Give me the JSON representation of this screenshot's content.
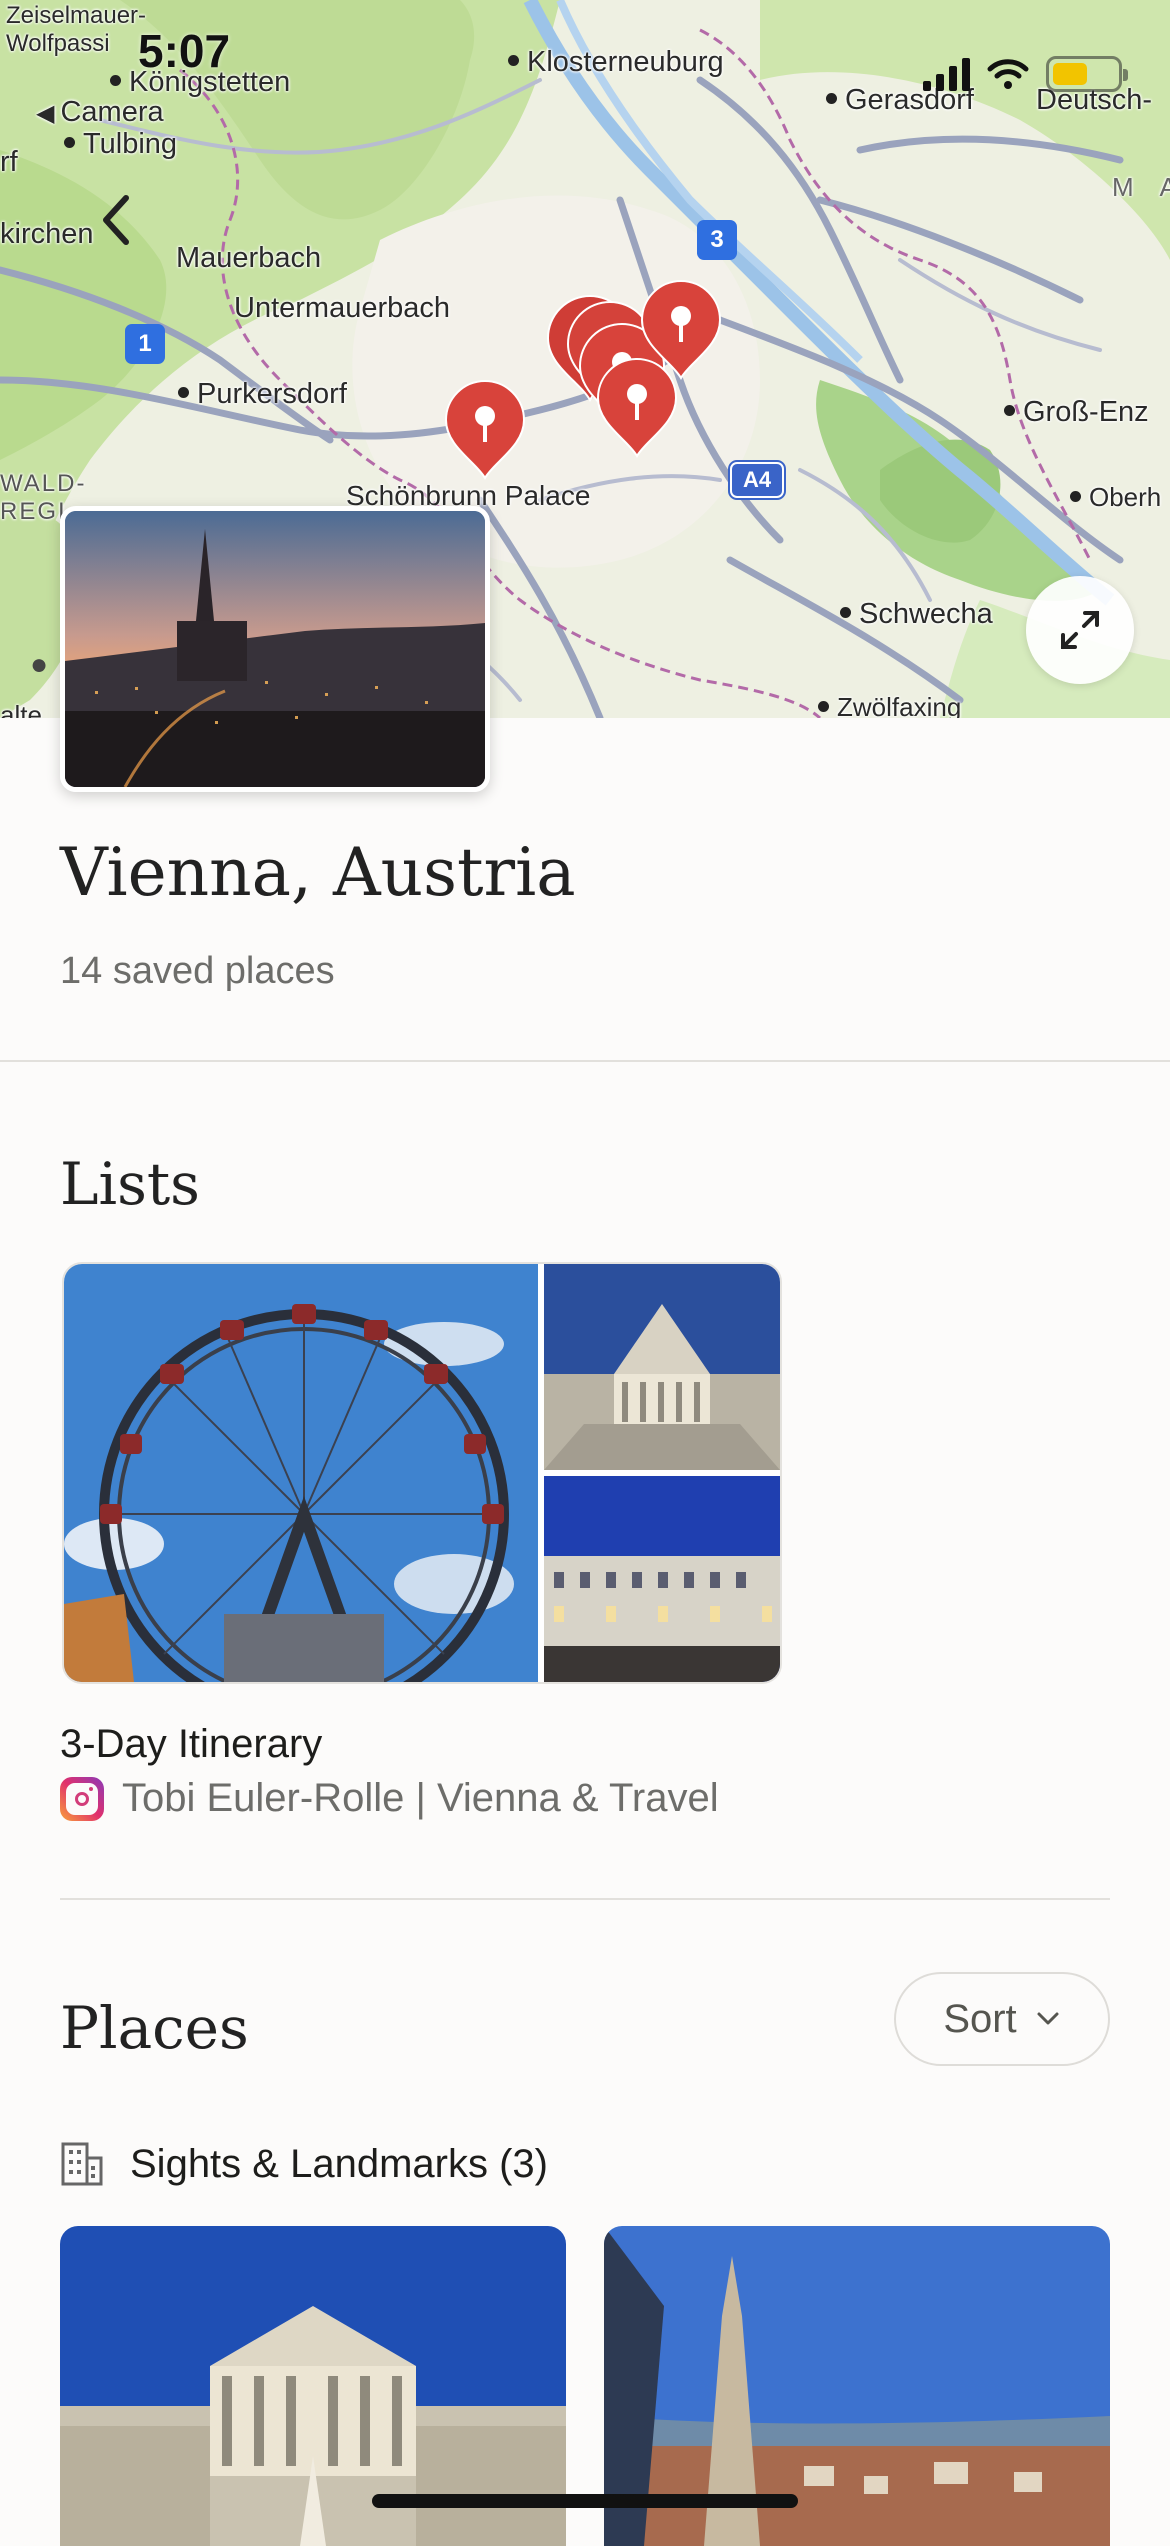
{
  "status_bar": {
    "time": "5:07"
  },
  "map": {
    "labels": {
      "zeiselmauer": "Zeiselmauer-",
      "wolfpassing": "Wolfpassi",
      "koenigstetten": "Königstetten",
      "klosterneuburg": "Klosterneuburg",
      "gerasdorf": "Gerasdorf",
      "deutsch": "Deutsch-",
      "camera": "Camera",
      "tulbing": "Tulbing",
      "orf": "rf",
      "kirchen": "kirchen",
      "mauerbach": "Mauerbach",
      "untermauerbach": "Untermauerbach",
      "purkersdorf": "Purkersdorf",
      "grossenz": "Groß-Enz",
      "oberh": "Oberh",
      "wald": "WALD-",
      "regi": "REGI",
      "schoenbrunn": "Schönbrunn Palace",
      "schwechat": "Schwecha",
      "zwoelfaxing": "Zwölfaxing",
      "alte": "alte",
      "m_letter": "M A"
    },
    "shields": {
      "route1": "1",
      "route3": "3",
      "a4": "A4"
    },
    "camera_back_glyph": "◀"
  },
  "hero": {
    "title": "Vienna, Austria",
    "subtitle": "14 saved places"
  },
  "lists": {
    "heading": "Lists",
    "items": [
      {
        "name": "3-Day Itinerary",
        "author": "Tobi Euler-Rolle | Vienna & Travel",
        "source_icon": "instagram-icon"
      }
    ]
  },
  "places": {
    "heading": "Places",
    "sort_label": "Sort",
    "category": {
      "label": "Sights & Landmarks (3)",
      "icon": "building-icon"
    }
  },
  "colors": {
    "background": "#fcfbfa",
    "pin": "#d8433b",
    "map_green": "#c9e3a6",
    "road": "#9aa3bd",
    "boundary": "#b36aa8",
    "text_muted": "#6d6d6a"
  }
}
